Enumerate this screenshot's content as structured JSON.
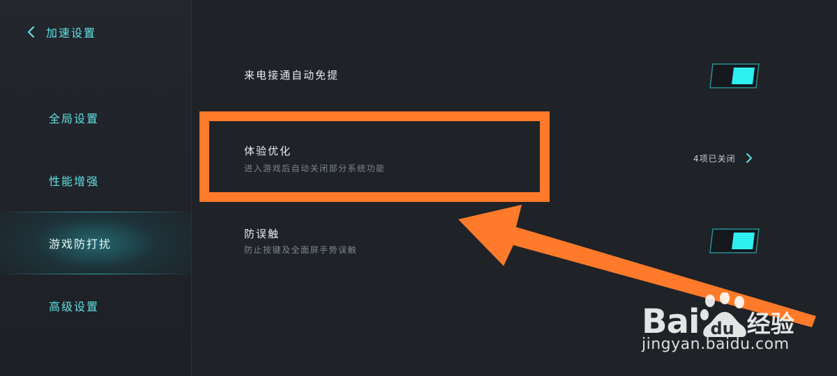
{
  "sidebar": {
    "back_label": "加速设置",
    "items": [
      {
        "label": "全局设置",
        "active": false
      },
      {
        "label": "性能增强",
        "active": false
      },
      {
        "label": "游戏防打扰",
        "active": true
      },
      {
        "label": "高级设置",
        "active": false
      }
    ]
  },
  "settings": {
    "auto_speaker": {
      "title": "来电接通自动免提",
      "enabled": true
    },
    "experience": {
      "title": "体验优化",
      "desc": "进入游戏后自动关闭部分系统功能",
      "value": "4项已关闭"
    },
    "mistouch": {
      "title": "防误触",
      "desc": "防止按键及全面屏手势误触",
      "enabled": true
    }
  },
  "watermark": {
    "logo_bai": "Bai",
    "logo_du": "du",
    "logo_jingyan": "经验",
    "url": "jingyan.baidu.com"
  },
  "colors": {
    "accent": "#5fe3e6",
    "toggle_on": "#2ef0f0",
    "annotation": "#ff7a2a",
    "background": "#1f2227"
  }
}
